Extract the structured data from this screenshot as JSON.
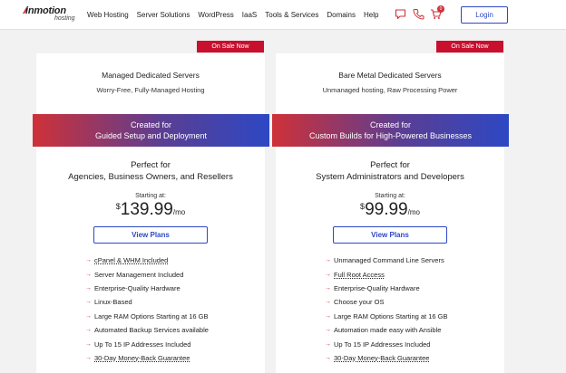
{
  "header": {
    "logo_main": "inmotion",
    "logo_sub": "hosting",
    "nav": [
      "Web Hosting",
      "Server Solutions",
      "WordPress",
      "IaaS",
      "Tools & Services",
      "Domains",
      "Help"
    ],
    "cart_count": "0",
    "login_label": "Login",
    "icons": [
      "chat-icon",
      "phone-icon",
      "cart-icon"
    ]
  },
  "colors": {
    "accent_red": "#cf3138",
    "accent_blue": "#2d48c4",
    "sale_red": "#c8102e"
  },
  "cards": [
    {
      "badge": "On Sale Now",
      "title": "Managed Dedicated Servers",
      "subtitle": "Worry-Free, Fully-Managed Hosting",
      "band_line1": "Created for",
      "band_line2": "Guided Setup and Deployment",
      "perfect_line1": "Perfect for",
      "perfect_line2": "Agencies, Business Owners, and Resellers",
      "starting_at": "Starting at:",
      "currency": "$",
      "price": "139.99",
      "period": "/mo",
      "button": "View Plans",
      "features": [
        "cPanel & WHM Included",
        "Server Management Included",
        "Enterprise-Quality Hardware",
        "Linux-Based",
        "Large RAM Options Starting at 16 GB",
        "Automated Backup Services available",
        "Up To 15 IP Addresses Included",
        "30-Day Money-Back Guarantee"
      ]
    },
    {
      "badge": "On Sale Now",
      "title": "Bare Metal Dedicated Servers",
      "subtitle": "Unmanaged hosting, Raw Processing Power",
      "band_line1": "Created for",
      "band_line2": "Custom Builds for High-Powered Businesses",
      "perfect_line1": "Perfect for",
      "perfect_line2": "System Administrators and Developers",
      "starting_at": "Starting at:",
      "currency": "$",
      "price": "99.99",
      "period": "/mo",
      "button": "View Plans",
      "features": [
        "Unmanaged Command Line Servers",
        "Full Root Access",
        "Enterprise-Quality Hardware",
        "Choose your OS",
        "Large RAM Options Starting at 16 GB",
        "Automation made easy with Ansible",
        "Up To 15 IP Addresses Included",
        "30-Day Money-Back Guarantee"
      ]
    }
  ]
}
